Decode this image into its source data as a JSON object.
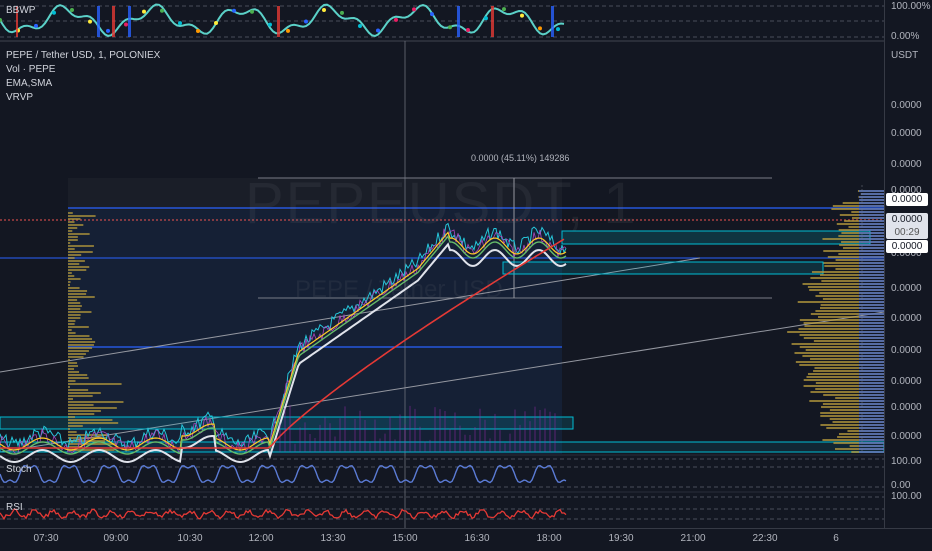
{
  "legend": {
    "symbol": "PEPE / Tether USD, 1, POLONIEX",
    "vol": "Vol · PEPE",
    "ema": "EMA,SMA",
    "vrvp": "VRVP"
  },
  "panels": {
    "bbwp": "BBWP",
    "stoch": "Stoch",
    "rsi": "RSI"
  },
  "watermark": {
    "symbol": "PEPEUSDT, 1",
    "name": "PEPE / Tether USD"
  },
  "measure_label": "0.0000 (45.11%) 149286",
  "currency": "USDT",
  "bbwp_scale": {
    "top": "100.00%",
    "bottom": "0.00%"
  },
  "price_ticks": [
    "0.0000",
    "0.0000",
    "0.0000",
    "0.0000",
    "0.0000",
    "0.0000",
    "0.0000",
    "0.0000",
    "0.0000",
    "0.0000",
    "0.0000",
    "0.0000"
  ],
  "price_boxes": {
    "top": "0.0000",
    "current": "0.0000",
    "countdown": "00:29",
    "bottom": "0.0000"
  },
  "stoch_scale": {
    "top": "100.00",
    "bottom": "0.00"
  },
  "rsi_scale": {
    "top": "100.00"
  },
  "time_ticks": [
    "07:30",
    "09:00",
    "10:30",
    "12:00",
    "13:30",
    "15:00",
    "16:30",
    "18:00",
    "19:30",
    "21:00",
    "22:30",
    "6"
  ],
  "colors": {
    "background": "#131722",
    "ema_red": "#e53935",
    "sma_white": "#e0e3eb",
    "stoch_line": "#5b7bd5",
    "rsi_line": "#e53935",
    "vrvp_bars": "#b59a3c",
    "level_blue": "#2962ff",
    "zone_cyan": "#00bcd4"
  }
}
